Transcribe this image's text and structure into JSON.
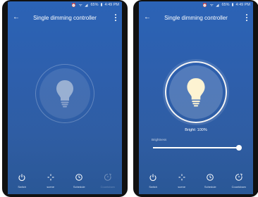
{
  "status_bar": {
    "time": "4:49 PM",
    "battery": "65%"
  },
  "phones": [
    {
      "app_bar": {
        "title": "Single dimming controller"
      },
      "bulb": {
        "state": "off"
      },
      "nav": [
        {
          "label": "Switch",
          "icon": "power-icon"
        },
        {
          "label": "scene",
          "icon": "sparkle-icon"
        },
        {
          "label": "Schedule",
          "icon": "clock-icon"
        },
        {
          "label": "Countdown",
          "icon": "timer-icon"
        }
      ]
    },
    {
      "app_bar": {
        "title": "Single dimming controller"
      },
      "bulb": {
        "state": "on"
      },
      "brightness": {
        "text": "Bright: 100%",
        "label": "Brightness",
        "value": 100
      },
      "nav": [
        {
          "label": "Switch",
          "icon": "power-icon"
        },
        {
          "label": "scene",
          "icon": "sparkle-icon"
        },
        {
          "label": "Schedule",
          "icon": "clock-icon"
        },
        {
          "label": "Countdown",
          "icon": "timer-icon"
        }
      ]
    }
  ],
  "colors": {
    "background_top": "#2b63b6",
    "background_bottom": "#2a5796",
    "bulb_on": "#fdf3d2"
  }
}
